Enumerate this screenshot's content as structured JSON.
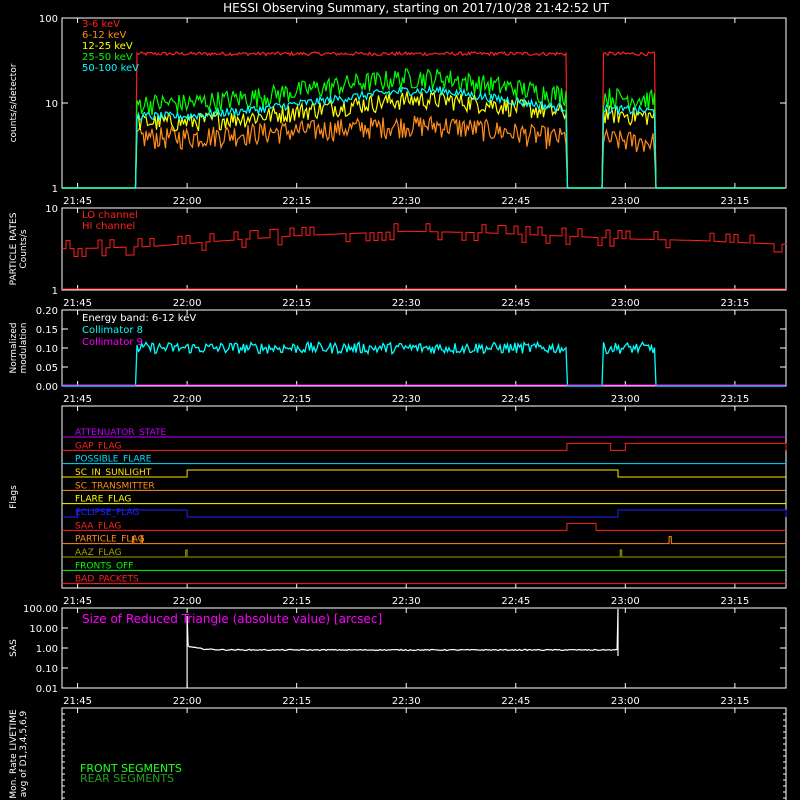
{
  "title": "HESSI Observing Summary, starting on 2017/10/28 21:42:52 UT",
  "time_ticks": [
    "21:45",
    "22:00",
    "22:15",
    "22:30",
    "22:45",
    "23:00",
    "23:15"
  ],
  "colors": {
    "bg": "#000000",
    "axis": "#ffffff",
    "e3_6": "#ff2020",
    "e6_12": "#ff8c1a",
    "e12_25": "#ffff00",
    "e25_50": "#00ff00",
    "e50_100": "#00ffff",
    "particle": "#ff2020",
    "modulation": "#00ffff",
    "magenta": "#ff00ff"
  },
  "chart_data": [
    {
      "type": "line",
      "panel": "count rates",
      "ylabel": "counts/s/detector",
      "yscale": "log",
      "ylim": [
        1,
        100
      ],
      "ytick_labels": [
        "1",
        "10",
        "100"
      ],
      "legend_placement": "top-left",
      "data_intervals": [
        [
          "21:53",
          "22:52"
        ],
        [
          "22:57",
          "23:04"
        ]
      ],
      "series": [
        {
          "name": "3-6 keV",
          "color": "#ff2020",
          "level": [
            38,
            38,
            38,
            38,
            38,
            38,
            38,
            38,
            38
          ],
          "noise": 0.05
        },
        {
          "name": "6-12 keV",
          "color": "#ff8c1a",
          "level": [
            4,
            4,
            4.5,
            5,
            5.5,
            5.5,
            5,
            4,
            3.5
          ],
          "noise": 0.3
        },
        {
          "name": "12-25 keV",
          "color": "#ffff00",
          "level": [
            6,
            6,
            7,
            9,
            11,
            11,
            10,
            8,
            7
          ],
          "noise": 0.25
        },
        {
          "name": "25-50 keV",
          "color": "#00ff00",
          "level": [
            10,
            10,
            12,
            16,
            20,
            20,
            17,
            13,
            11
          ],
          "noise": 0.28
        },
        {
          "name": "50-100 keV",
          "color": "#00ffff",
          "level": [
            7,
            7,
            8.5,
            11,
            14,
            14,
            12,
            9,
            8
          ],
          "noise": 0.12
        }
      ],
      "level_times": [
        "21:53",
        "22:00",
        "22:10",
        "22:20",
        "22:30",
        "22:35",
        "22:40",
        "22:50",
        "23:04"
      ]
    },
    {
      "type": "line",
      "panel": "particle rates",
      "ylabel": "PARTICLE RATES\nCounts/s",
      "yscale": "log",
      "ylim": [
        1,
        10
      ],
      "ytick_labels": [
        "1",
        "10"
      ],
      "legend_placement": "top-left",
      "series": [
        {
          "name": "LO channel",
          "color": "#ff2020",
          "values": []
        },
        {
          "name": "HI channel",
          "color": "#ff2020",
          "level": [
            3.2,
            3.4,
            4.0,
            4.6,
            5.2,
            5.0,
            4.6,
            4.2,
            4.0,
            3.8,
            3.6
          ],
          "steps": [
            0.6,
            1.0
          ]
        }
      ],
      "level_times": [
        "21:45",
        "21:55",
        "22:05",
        "22:15",
        "22:30",
        "22:40",
        "22:50",
        "23:00",
        "23:10",
        "23:15",
        "23:22"
      ]
    },
    {
      "type": "line",
      "panel": "modulation",
      "ylabel": "Normalized\nmodulation",
      "ylim": [
        0.0,
        0.2
      ],
      "ytick_labels": [
        "0.00",
        "0.05",
        "0.10",
        "0.15",
        "0.20"
      ],
      "legend_title": "Energy band: 6-12 keV",
      "series": [
        {
          "name": "Collimator 8",
          "color": "#00ffff",
          "mean": 0.1,
          "spread": 0.015
        },
        {
          "name": "Collimator 9",
          "color": "#ff00ff",
          "mean": 0.0,
          "spread": 0.0
        }
      ],
      "data_intervals": [
        [
          "21:53",
          "22:52"
        ],
        [
          "22:57",
          "23:04"
        ]
      ]
    },
    {
      "type": "table",
      "panel": "flags",
      "ylabel": "Flags",
      "flags": [
        {
          "name": "ATTENUATOR_STATE",
          "color": "#c000ff",
          "high": []
        },
        {
          "name": "GAP_FLAG",
          "color": "#ff2020",
          "high": [
            [
              "22:52",
              "22:58"
            ],
            [
              "23:00",
              "23:22"
            ]
          ]
        },
        {
          "name": "POSSIBLE_FLARE",
          "color": "#00e0ff",
          "high": []
        },
        {
          "name": "SC_IN_SUNLIGHT",
          "color": "#ffe000",
          "high": [
            [
              "22:00",
              "22:59"
            ]
          ]
        },
        {
          "name": "SC_TRANSMITTER",
          "color": "#ff8c1a",
          "high": []
        },
        {
          "name": "FLARE_FLAG",
          "color": "#ffff00",
          "high": []
        },
        {
          "name": "ECLIPSE_FLAG",
          "color": "#2020ff",
          "high": [
            [
              "21:45",
              "22:00"
            ],
            [
              "22:59",
              "23:22"
            ]
          ]
        },
        {
          "name": "SAA_FLAG",
          "color": "#ff2020",
          "high": [
            [
              "22:52",
              "22:56"
            ]
          ]
        },
        {
          "name": "PARTICLE_FLAG",
          "color": "#ff8c1a",
          "high": [
            [
              "21:52.5",
              "21:52.7"
            ],
            [
              "21:53.7",
              "21:53.9"
            ],
            [
              "23:06",
              "23:06.3"
            ]
          ]
        },
        {
          "name": "AAZ_FLAG",
          "color": "#a0a000",
          "high": [
            [
              "21:59.8",
              "22:00"
            ],
            [
              "22:59.3",
              "22:59.5"
            ]
          ]
        },
        {
          "name": "FRONTS_OFF",
          "color": "#00ff00",
          "high": []
        },
        {
          "name": "BAD_PACKETS",
          "color": "#ff2020",
          "high": []
        }
      ]
    },
    {
      "type": "line",
      "panel": "SAS",
      "ylabel": "SAS",
      "yscale": "log",
      "ylim": [
        0.01,
        100
      ],
      "ytick_labels": [
        "0.01",
        "0.10",
        "1.00",
        "10.00",
        "100.00"
      ],
      "annotation": "Size of Reduced Triangle (absolute value) [arcsec]",
      "series": [
        {
          "name": "Size of Reduced Triangle",
          "color": "#ffffff",
          "interval": [
            "22:00",
            "22:59"
          ],
          "level": 0.8
        }
      ]
    },
    {
      "type": "line",
      "panel": "monitor rates",
      "ylabel": "Mon. Rate LIVETIME\navg of D1,3,4,5,6,9",
      "series": [
        {
          "name": "FRONT SEGMENTS",
          "color": "#20ff20",
          "values": []
        },
        {
          "name": "REAR SEGMENTS",
          "color": "#20a020",
          "values": []
        }
      ]
    }
  ]
}
